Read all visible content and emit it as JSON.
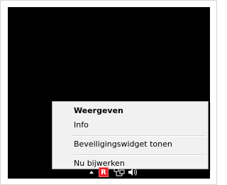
{
  "context_menu": {
    "items": [
      {
        "label": "Weergeven"
      },
      {
        "label": "Info"
      },
      {
        "label": "Beveiligingswidget tonen"
      },
      {
        "label": "Nu bijwerken"
      }
    ]
  },
  "tray": {
    "icons": [
      {
        "name": "show-hidden-icons-arrow-icon"
      },
      {
        "name": "security-app-icon",
        "glyph": "R",
        "color": "#e8202a"
      },
      {
        "name": "network-icon"
      },
      {
        "name": "volume-icon"
      }
    ]
  }
}
